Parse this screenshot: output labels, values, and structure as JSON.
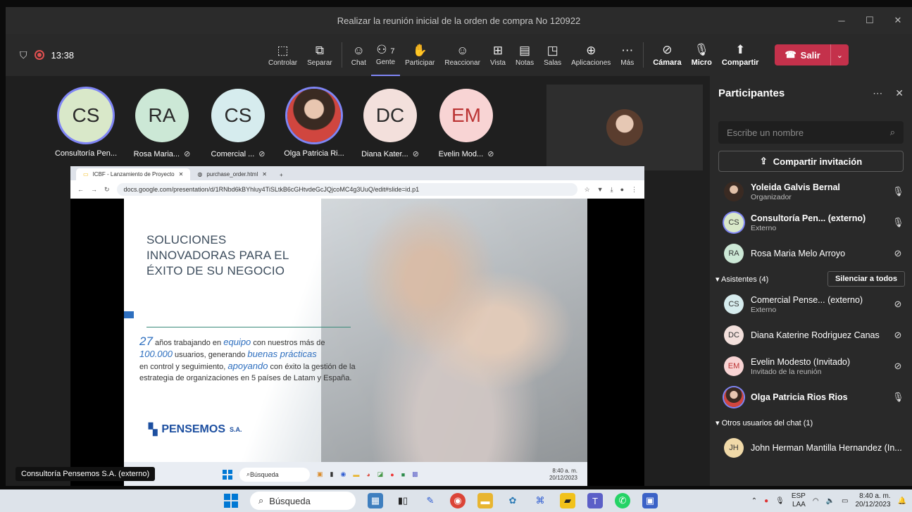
{
  "window": {
    "title": "Realizar la reunión inicial de la orden de compra No 120922"
  },
  "toolbar": {
    "elapsed": "13:38",
    "people_count": "7",
    "buttons": {
      "control": "Controlar",
      "separate": "Separar",
      "chat": "Chat",
      "people": "Gente",
      "raise": "Participar",
      "react": "Reaccionar",
      "view": "Vista",
      "notes": "Notas",
      "rooms": "Salas",
      "apps": "Aplicaciones",
      "more": "Más",
      "camera": "Cámara",
      "mic": "Micro",
      "share": "Compartir",
      "leave": "Salir"
    }
  },
  "stage": {
    "participants": [
      {
        "initials": "CS",
        "name": "Consultoría Pen...",
        "muted": false,
        "color": "#d9e8c9",
        "speaking": true
      },
      {
        "initials": "RA",
        "name": "Rosa Maria...",
        "muted": true,
        "color": "#cce8d6",
        "speaking": false
      },
      {
        "initials": "CS",
        "name": "Comercial ...",
        "muted": true,
        "color": "#d6ecee",
        "speaking": false
      },
      {
        "initials": "",
        "name": "Olga Patricia Ri...",
        "muted": false,
        "color": "#ffffff",
        "speaking": true
      },
      {
        "initials": "DC",
        "name": "Diana Kater...",
        "muted": true,
        "color": "#f3e0dc",
        "speaking": false
      },
      {
        "initials": "EM",
        "name": "Evelin Mod...",
        "muted": true,
        "color": "#f8d4d4",
        "speaking": false
      }
    ],
    "presenter_tag": "Consultoría Pensemos S.A. (externo)"
  },
  "browser": {
    "tab1": "ICBF - Lanzamiento de Proyecto",
    "tab2": "purchase_order.html",
    "url": "docs.google.com/presentation/d/1RNbd6kBYhluy4TiSLtkB6cGHtvdeGcJQjcoMC4g3UuQ/edit#slide=id.p1"
  },
  "slide": {
    "title_l1": "SOLUCIONES",
    "title_l2": "INNOVADORAS PARA EL",
    "title_l3": "ÉXITO DE SU NEGOCIO",
    "b_years": "27",
    "b_t1": " años trabajando en ",
    "b_team": "equipo",
    "b_t2": " con nuestros más de",
    "b_users": "100.000",
    "b_t3": " usuarios, generando ",
    "b_practices": "buenas prácticas",
    "b_t4": "en control y seguimiento, ",
    "b_support": "apoyando",
    "b_t5": " con éxito la gestión de la estrategia de organizaciones en 5 países de Latam y España.",
    "logo": "PENSEMOS",
    "logo_suffix": "S.A."
  },
  "inner_taskbar": {
    "search": "Búsqueda",
    "time": "8:40 a. m.",
    "date": "20/12/2023"
  },
  "panel": {
    "title": "Participantes",
    "search_placeholder": "Escribe un nombre",
    "invite": "Compartir invitación",
    "top": [
      {
        "initials": "",
        "name": "Yoleida Galvis Bernal",
        "role": "Organizador",
        "mic": "on",
        "color": "#ffffff"
      },
      {
        "initials": "CS",
        "name": "Consultoría Pen... (externo)",
        "role": "Externo",
        "mic": "on",
        "color": "#d9e8c9"
      },
      {
        "initials": "RA",
        "name": "Rosa Maria Melo Arroyo",
        "role": "",
        "mic": "off",
        "color": "#cce8d6"
      }
    ],
    "attendees_label": "Asistentes (4)",
    "mute_all": "Silenciar a todos",
    "attendees": [
      {
        "initials": "CS",
        "name": "Comercial Pense... (externo)",
        "role": "Externo",
        "mic": "off",
        "color": "#d6ecee"
      },
      {
        "initials": "DC",
        "name": "Diana Katerine Rodriguez Canas",
        "role": "",
        "mic": "off",
        "color": "#f3e0dc"
      },
      {
        "initials": "EM",
        "name": "Evelin Modesto (Invitado)",
        "role": "Invitado de la reunión",
        "mic": "off",
        "color": "#f8d4d4"
      },
      {
        "initials": "",
        "name": "Olga Patricia Rios Rios",
        "role": "",
        "mic": "on",
        "color": "#ffffff"
      }
    ],
    "others_label": "Otros usuarios del chat (1)",
    "others": [
      {
        "initials": "JH",
        "name": "John Herman Mantilla Hernandez (In...",
        "role": "",
        "color": "#f0d9a8"
      }
    ]
  },
  "taskbar": {
    "search": "Búsqueda",
    "lang1": "ESP",
    "lang2": "LAA",
    "time": "8:40 a. m.",
    "date": "20/12/2023"
  }
}
